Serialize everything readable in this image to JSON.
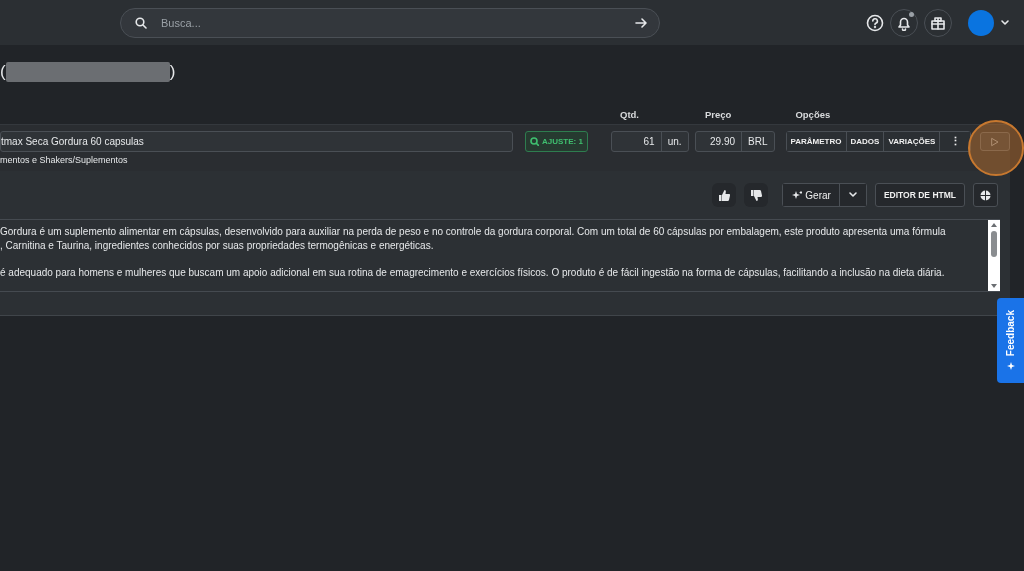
{
  "search": {
    "placeholder": "Busca..."
  },
  "notifications": {
    "unread": true
  },
  "title": {
    "open": "(",
    "close": ")"
  },
  "columns": [
    "Qtd.",
    "Preço",
    "Opções"
  ],
  "product": {
    "name": "tmax Seca Gordura 60 capsulas",
    "category": "mentos e Shakers/Suplementos",
    "adjust": "AJUSTE: 1",
    "qty": "61",
    "qty_unit": "un.",
    "price": "29.90",
    "currency": "BRL",
    "options": [
      "PARÂMETRO",
      "DADOS",
      "VARIAÇÕES",
      "⋮"
    ]
  },
  "description": {
    "generate": "Gerar",
    "html_editor": "EDITOR DE HTML",
    "paragraphs": [
      [
        "Gordura é um suplemento alimentar em cápsulas, desenvolvido para auxiliar na perda de peso e no controle da gordura corporal. Com um total de 60 cápsulas por embalagem, este produto apresenta uma fórmula",
        ", Carnitina e Taurina, ingredientes conhecidos por suas propriedades termogênicas e energéticas."
      ],
      [
        "é adequado para homens e mulheres que buscam um apoio adicional em sua rotina de emagrecimento e exercícios físicos. O produto é de fácil ingestão na forma de cápsulas, facilitando a inclusão na dieta diária."
      ]
    ]
  },
  "feedback": "Feedback"
}
